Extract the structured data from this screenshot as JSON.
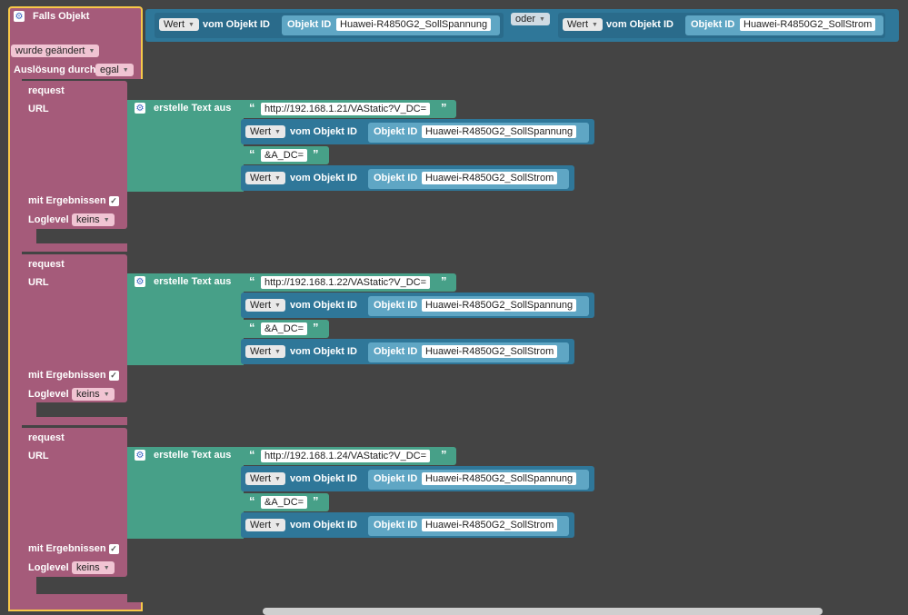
{
  "trigger": {
    "title": "Falls Objekt",
    "changed_option": "wurde geändert",
    "trigger_by_label": "Auslösung durch",
    "trigger_by_value": "egal",
    "or_label": "oder",
    "conditions": [
      {
        "value_dropdown": "Wert",
        "from_label": "vom Objekt ID",
        "oid_label": "Objekt ID",
        "oid": "Huawei-R4850G2_SollSpannung"
      },
      {
        "value_dropdown": "Wert",
        "from_label": "vom Objekt ID",
        "oid_label": "Objekt ID",
        "oid": "Huawei-R4850G2_SollStrom"
      }
    ]
  },
  "requests": [
    {
      "title": "request",
      "url_label": "URL",
      "text_label": "erstelle Text aus",
      "part1": "http://192.168.1.21/VAStatic?V_DC=",
      "voltage": {
        "dropdown": "Wert",
        "from": "vom Objekt ID",
        "oid_label": "Objekt ID",
        "oid": "Huawei-R4850G2_SollSpannung"
      },
      "part2": "&A_DC=",
      "current": {
        "dropdown": "Wert",
        "from": "vom Objekt ID",
        "oid_label": "Objekt ID",
        "oid": "Huawei-R4850G2_SollStrom"
      },
      "results_label": "mit Ergebnissen",
      "loglevel_label": "Loglevel",
      "loglevel": "keins"
    },
    {
      "title": "request",
      "url_label": "URL",
      "text_label": "erstelle Text aus",
      "part1": "http://192.168.1.22/VAStatic?V_DC=",
      "voltage": {
        "dropdown": "Wert",
        "from": "vom Objekt ID",
        "oid_label": "Objekt ID",
        "oid": "Huawei-R4850G2_SollSpannung"
      },
      "part2": "&A_DC=",
      "current": {
        "dropdown": "Wert",
        "from": "vom Objekt ID",
        "oid_label": "Objekt ID",
        "oid": "Huawei-R4850G2_SollStrom"
      },
      "results_label": "mit Ergebnissen",
      "loglevel_label": "Loglevel",
      "loglevel": "keins"
    },
    {
      "title": "request",
      "url_label": "URL",
      "text_label": "erstelle Text aus",
      "part1": "http://192.168.1.24/VAStatic?V_DC=",
      "voltage": {
        "dropdown": "Wert",
        "from": "vom Objekt ID",
        "oid_label": "Objekt ID",
        "oid": "Huawei-R4850G2_SollSpannung"
      },
      "part2": "&A_DC=",
      "current": {
        "dropdown": "Wert",
        "from": "vom Objekt ID",
        "oid_label": "Objekt ID",
        "oid": "Huawei-R4850G2_SollStrom"
      },
      "results_label": "mit Ergebnissen",
      "loglevel_label": "Loglevel",
      "loglevel": "keins"
    }
  ],
  "colors": {
    "workspace": "#444444",
    "event_block": "#a55b7a",
    "text_block": "#47a088",
    "object_block": "#2f7799",
    "selection": "#f7c948"
  },
  "icons": {
    "gear": "gear-icon",
    "checkbox": "checkmark-icon"
  }
}
